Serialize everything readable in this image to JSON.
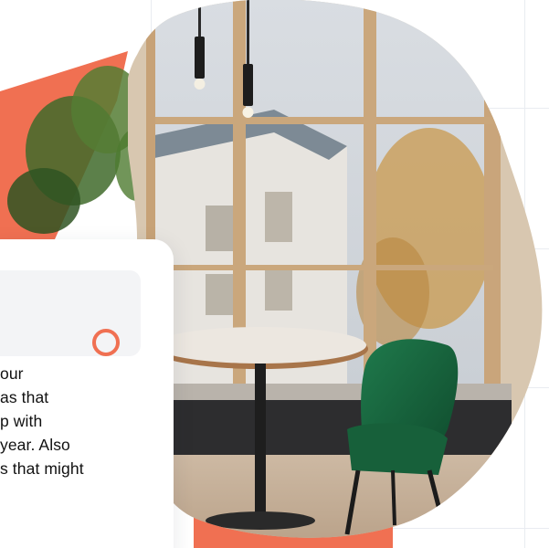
{
  "colors": {
    "accent": "#f07052",
    "background": "#ffffff",
    "grid_line": "#e9ecf1",
    "card_field": "#f3f4f6"
  },
  "icons": {
    "status": "ring-icon"
  },
  "card": {
    "text_lines": [
      "our",
      "as that",
      "p with",
      "year. Also",
      "s that might"
    ]
  }
}
